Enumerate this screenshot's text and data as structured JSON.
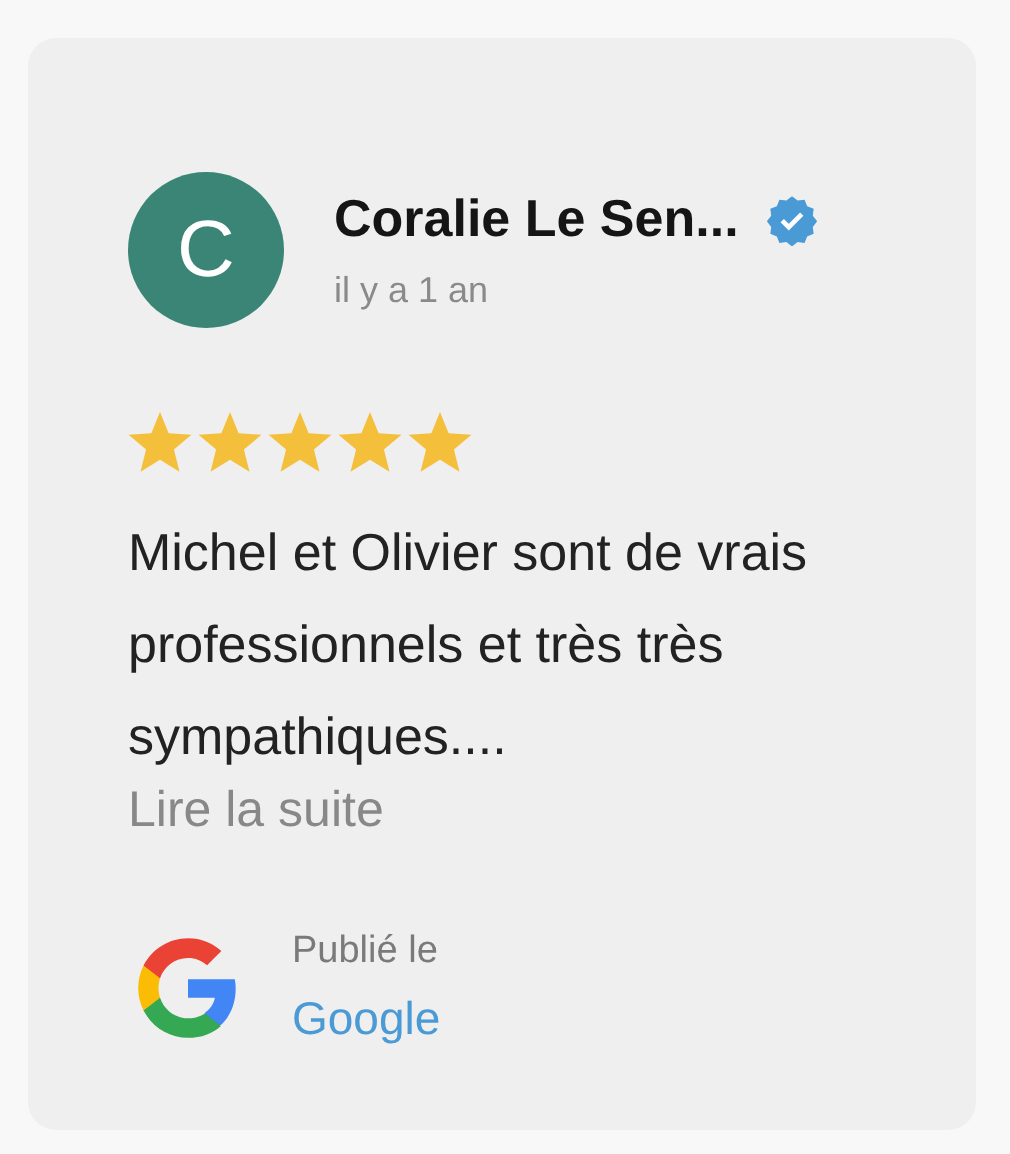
{
  "review": {
    "avatar_letter": "C",
    "author": "Coralie Le Sen...",
    "verified": true,
    "time": "il y a 1 an",
    "stars": 5,
    "text": "Michel et Olivier sont de vrais professionnels et très très sympathiques....",
    "read_more": "Lire la suite",
    "source_label": "Publié le",
    "source": "Google"
  }
}
